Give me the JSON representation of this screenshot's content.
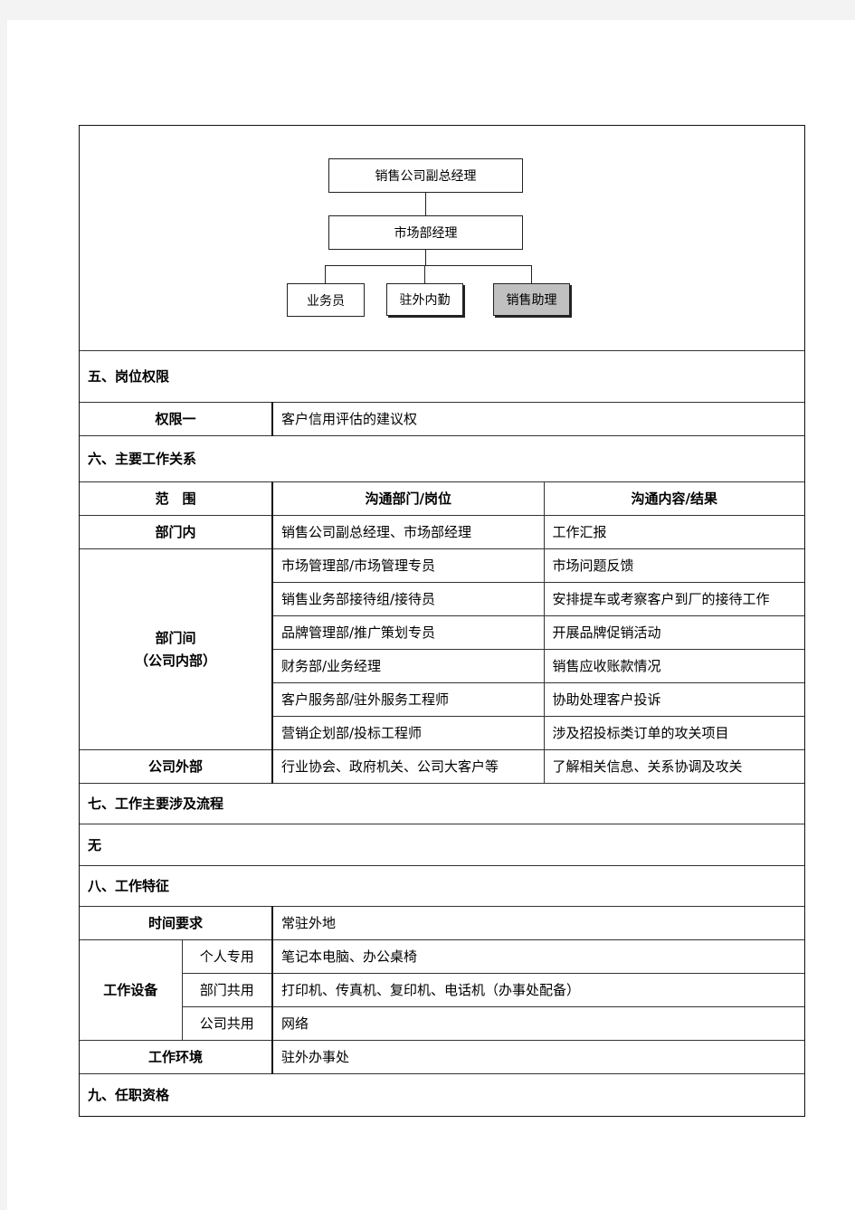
{
  "org_chart": {
    "top": "销售公司副总经理",
    "middle": "市场部经理",
    "children": [
      "业务员",
      "驻外内勤",
      "销售助理"
    ],
    "highlighted": "销售助理",
    "highlight_color": "#c0c0c0"
  },
  "section5": {
    "title": "五、岗位权限",
    "rows": [
      {
        "label": "权限一",
        "value": "客户信用评估的建议权"
      }
    ]
  },
  "section6": {
    "title": "六、主要工作关系",
    "headers": [
      "范　围",
      "沟通部门/岗位",
      "沟通内容/结果"
    ],
    "groups": [
      {
        "scope": "部门内",
        "rows": [
          {
            "dept": "销售公司副总经理、市场部经理",
            "content": "工作汇报"
          }
        ]
      },
      {
        "scope": "部门间",
        "scope_sub": "（公司内部）",
        "rows": [
          {
            "dept": "市场管理部/市场管理专员",
            "content": "市场问题反馈"
          },
          {
            "dept": "销售业务部接待组/接待员",
            "content": "安排提车或考察客户到厂的接待工作"
          },
          {
            "dept": "品牌管理部/推广策划专员",
            "content": "开展品牌促销活动"
          },
          {
            "dept": "财务部/业务经理",
            "content": "销售应收账款情况"
          },
          {
            "dept": "客户服务部/驻外服务工程师",
            "content": "协助处理客户投诉"
          },
          {
            "dept": "营销企划部/投标工程师",
            "content": "涉及招投标类订单的攻关项目"
          }
        ]
      },
      {
        "scope": "公司外部",
        "rows": [
          {
            "dept": "行业协会、政府机关、公司大客户等",
            "content": "了解相关信息、关系协调及攻关"
          }
        ]
      }
    ]
  },
  "section7": {
    "title": "七、工作主要涉及流程",
    "content": "无"
  },
  "section8": {
    "title": "八、工作特征",
    "time_label": "时间要求",
    "time_value": "常驻外地",
    "equipment_label": "工作设备",
    "equipment": [
      {
        "type": "个人专用",
        "value": "笔记本电脑、办公桌椅"
      },
      {
        "type": "部门共用",
        "value": "打印机、传真机、复印机、电话机（办事处配备）"
      },
      {
        "type": "公司共用",
        "value": "网络"
      }
    ],
    "env_label": "工作环境",
    "env_value": "驻外办事处"
  },
  "section9": {
    "title": "九、任职资格"
  }
}
